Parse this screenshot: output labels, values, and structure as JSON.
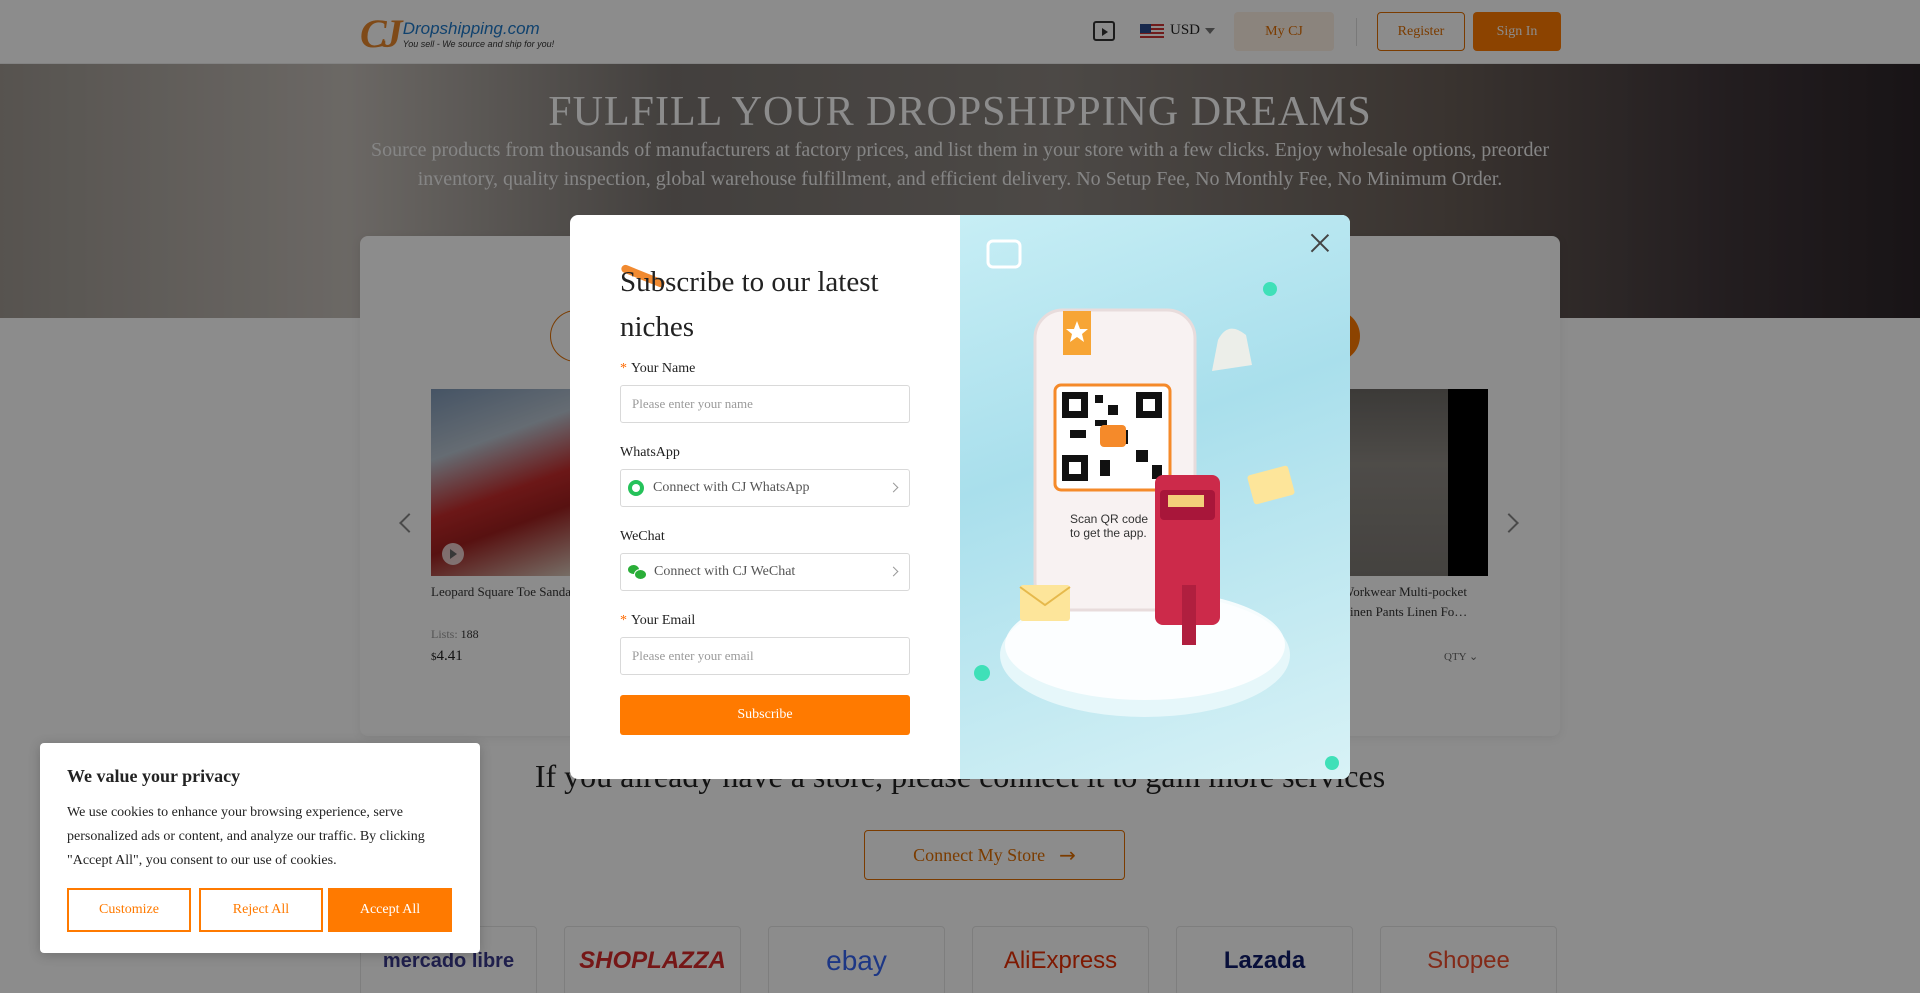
{
  "header": {
    "logo_name": "Dropshipping.com",
    "logo_slogan": "You sell - We source and ship for you!",
    "currency": "USD",
    "mycj_label": "My CJ",
    "register_label": "Register",
    "signin_label": "Sign In"
  },
  "hero": {
    "title": "FULFILL YOUR DROPSHIPPING DREAMS",
    "subtitle": "Source products from thousands of manufacturers at factory prices, and list them in your store with a few clicks. Enjoy wholesale options, preorder inventory, quality inspection, global warehouse fulfillment, and efficient delivery. No Setup Fee, No Monthly Fee, No Minimum Order."
  },
  "products": [
    {
      "title": "Leopard Square Toe Sandals Summer High-heeled Slip",
      "lists_label": "Lists:",
      "lists_value": "188",
      "price_symbol": "$",
      "price": "4.41"
    },
    {
      "title": "Workwear Multi-pocket Linen Pants Linen Fo…",
      "qty_label": "QTY"
    }
  ],
  "connect": {
    "title": "If you already have a store, please connect it to gain more services",
    "button_label": "Connect My Store"
  },
  "platforms": [
    "mercado libre",
    "SHOPLAZZA",
    "ebay",
    "AliExpress",
    "Lazada",
    "Shopee"
  ],
  "modal": {
    "title": "Subscribe to our latest niches",
    "name_label": "Your Name",
    "name_placeholder": "Please enter your name",
    "whatsapp_label": "WhatsApp",
    "whatsapp_value": "Connect with CJ WhatsApp",
    "wechat_label": "WeChat",
    "wechat_value": "Connect with CJ WeChat",
    "email_label": "Your Email",
    "email_placeholder": "Please enter your email",
    "required_mark": "*",
    "subscribe_label": "Subscribe",
    "qr_text_line1": "Scan QR code",
    "qr_text_line2": "to get the app."
  },
  "cookie": {
    "title": "We value your privacy",
    "text": "We use cookies to enhance your browsing experience, serve personalized ads or content, and analyze our traffic. By clicking \"Accept All\", you consent to our use of cookies.",
    "customize_label": "Customize",
    "reject_label": "Reject All",
    "accept_label": "Accept All"
  },
  "colors": {
    "accent": "#ff7a00",
    "brand_blue": "#1e78c8"
  }
}
